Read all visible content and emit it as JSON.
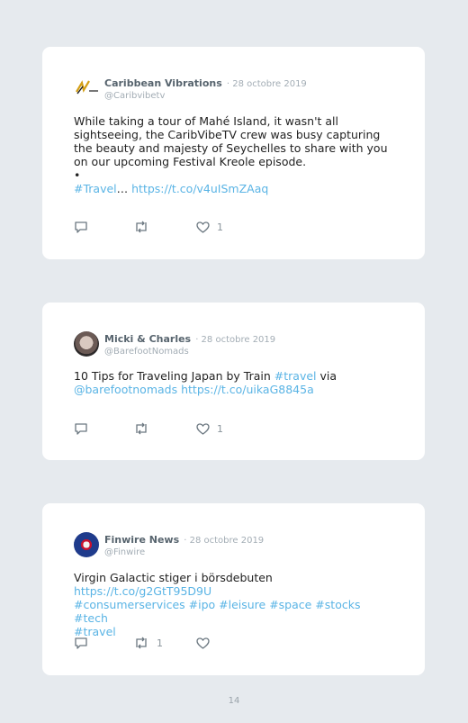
{
  "tweets": [
    {
      "author": "Caribbean Vibrations",
      "date": "· 28 octobre 2019",
      "handle": "@Caribvibetv",
      "text_1": "While taking a tour of Mahé Island, it wasn't all sightseeing, the CaribVibeTV crew was busy capturing the beauty and majesty of Seychelles to share with you on our upcoming Festival Kreole episode.",
      "text_2": "•",
      "hashtag": "#Travel",
      "ellipsis": "… ",
      "link": "https://t.co/v4uISmZAaq",
      "likes": "1",
      "retweets": ""
    },
    {
      "author": "Micki & Charles",
      "date": "· 28 octobre 2019",
      "handle": "@BarefootNomads",
      "text_1": "10 Tips for Traveling Japan by Train ",
      "hashtag": "#travel",
      "text_2": " via",
      "mention": "@barefootnomads",
      "link": "https://t.co/uikaG8845a",
      "likes": "1",
      "retweets": ""
    },
    {
      "author": "Finwire News",
      "date": "· 28 octobre 2019",
      "handle": "@Finwire",
      "text_1": "Virgin Galactic stiger i börsdebuten ",
      "link": "https://t.co/g2GtT95D9U",
      "hashtags": "#consumerservices #ipo #leisure #space #stocks #tech",
      "hashtag_last": "#travel",
      "likes": "",
      "retweets": "1"
    }
  ],
  "page_number": "14",
  "colors": {
    "background": "#e6eaee",
    "card": "#ffffff",
    "link": "#5ab4e5",
    "icon": "#6b7780"
  },
  "icons": [
    "reply-icon",
    "retweet-icon",
    "heart-icon"
  ]
}
